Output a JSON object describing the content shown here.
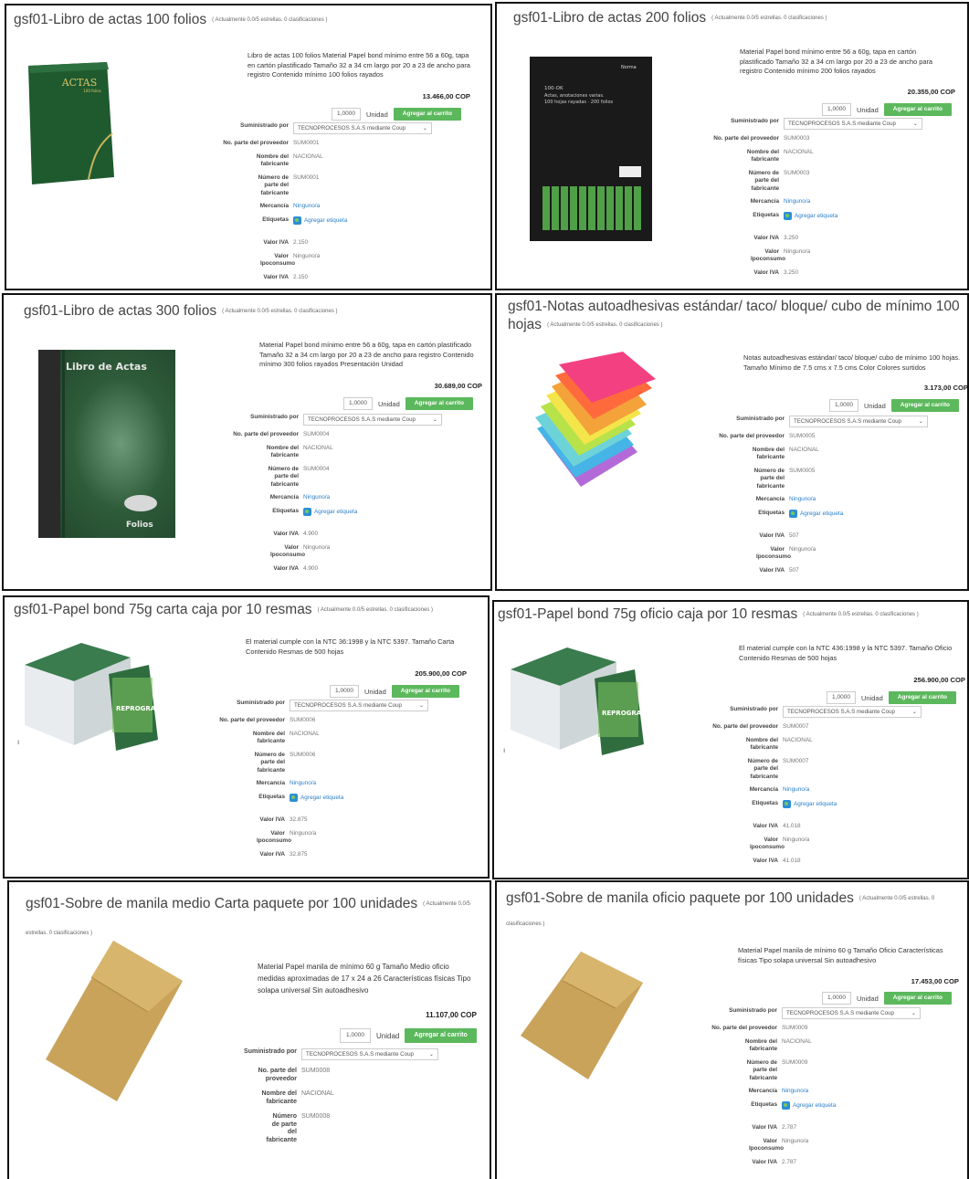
{
  "common": {
    "rating": "( Actualmente 0.0/5 estrellas. 0 clasificaciones )",
    "unit": "Unidad",
    "qty": "1,0000",
    "add_to_cart": "Agregar al carrito",
    "supplier_label": "Suministrado por",
    "supplier_value": "TECNOPROCESOS S.A.S mediante Coup",
    "part_label": "No. parte del proveedor",
    "manufacturer_label": "Nombre del fabricante",
    "manufacturer_value": "NACIONAL",
    "manufacturer_part_label": "Número de parte del fabricante",
    "merchandise_label": "Mercancía",
    "merchandise_value": "Ninguno/a",
    "tags_label": "Etiquetas",
    "tags_value": "Agregar etiqueta",
    "iva_label": "Valor IVA",
    "ipoconsumo_label": "Valor Ipoconsumo",
    "ipoconsumo_value": "Ninguno/a",
    "side_mark": "ı"
  },
  "products": [
    {
      "title": "gsf01-Libro de actas 100 folios",
      "description": "Libro de actas 100 folios Material Papel bond mínimo entre 56 a 60g, tapa en cartón plastificado Tamaño 32 a 34 cm largo por 20 a 23 de ancho para registro Contenido mínimo 100 folios rayados",
      "price": "13.466,00 COP",
      "part": "SUM0001",
      "iva": "2.150",
      "image_text": "ACTAS",
      "image_sub": "100 folios"
    },
    {
      "title": "gsf01-Libro de actas 200 folios",
      "description": "Material Papel bond mínimo entre 56 a 60g, tapa en cartón plastificado Tamaño 32 a 34 cm largo por 20 a 23 de ancho para registro Contenido mínimo 200 folios rayados",
      "price": "20.355,00 COP",
      "part": "SUM0003",
      "iva": "3.250",
      "image_text": "100-OK\nActas, anotaciones varias.\n100 hojas rayadas · 200 folios",
      "image_brand": "Norma"
    },
    {
      "title": "gsf01-Libro de actas 300 folios",
      "description": "Material Papel bond mínimo entre 56 a 60g, tapa en cartón plastificado Tamaño 32 a 34 cm largo por 20 a 23 de ancho para registro Contenido mínimo 300 folios rayados Presentación Unidad",
      "price": "30.689,00 COP",
      "part": "SUM0004",
      "iva": "4.900",
      "image_text": "Libro de Actas",
      "image_sub": "Folios"
    },
    {
      "title": "gsf01-Notas autoadhesivas estándar/ taco/ bloque/ cubo de mínimo 100 hojas",
      "description": "Notas autoadhesivas estándar/ taco/ bloque/ cubo de mínimo 100 hojas. Tamaño Mínimo de 7.5 cms x 7.5 cms Color Colores surtidos",
      "price": "3.173,00 COP",
      "part": "SUM0005",
      "iva": "507"
    },
    {
      "title": "gsf01-Papel bond 75g carta caja por 10 resmas",
      "description": "El material cumple con la NTC 36:1998 y la NTC 5397. Tamaño Carta Contenido Resmas de 500 hojas",
      "price": "205.900,00 COP",
      "part": "SUM0006",
      "iva": "32.875",
      "image_text": "REPROGRAF"
    },
    {
      "title": "gsf01-Papel bond 75g oficio caja por 10 resmas",
      "description": "El material cumple con la NTC 436:1998 y la NTC 5397. Tamaño Oficio Contenido Resmas de 500 hojas",
      "price": "256.900,00 COP",
      "part": "SUM0007",
      "iva": "41.018",
      "image_text": "REPROGRAF"
    },
    {
      "title": "gsf01-Sobre de manila medio Carta paquete por 100 unidades",
      "rating": "( Actualmente 0.0/5 estrellas. 0 clasificaciones )",
      "description": "Material Papel manila de mínimo 60 g Tamaño Medio oficio medidas aproximadas de 17 x 24 a 26 Características físicas Tipo solapa universal Sin autoadhesivo",
      "price": "11.107,00 COP",
      "part": "SUM0008"
    },
    {
      "title": "gsf01-Sobre de manila oficio paquete por 100 unidades",
      "description": "Material Papel manila de mínimo 60 g Tamaño Oficio Características físicas Tipo solapa universal Sin autoadhesivo",
      "price": "17.453,00 COP",
      "part": "SUM0009",
      "iva": "2.787"
    }
  ]
}
